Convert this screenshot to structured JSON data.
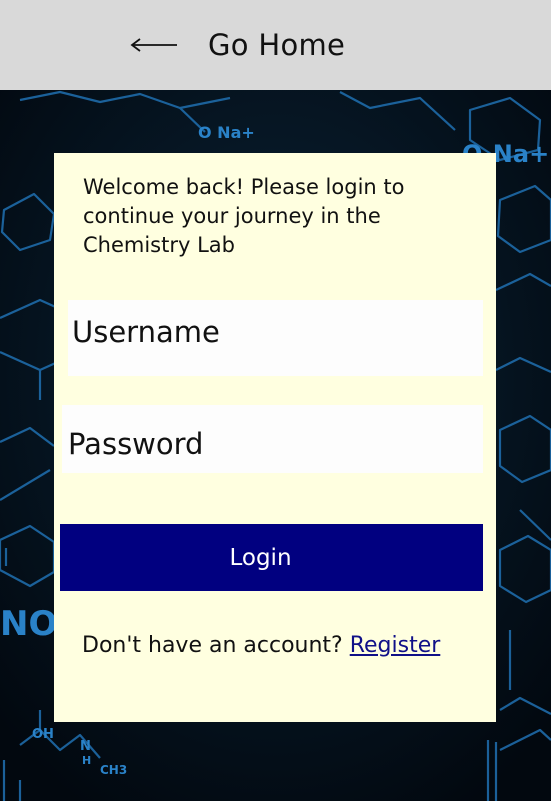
{
  "header": {
    "back_label": "Go Home"
  },
  "login_card": {
    "intro_text": "Welcome back! Please login to continue your journey in the Chemistry Lab",
    "username": {
      "placeholder": "Username",
      "value": ""
    },
    "password": {
      "placeholder": "Password",
      "value": ""
    },
    "login_button_label": "Login",
    "register_prompt": "Don't have an account? ",
    "register_link_label": "Register"
  },
  "background": {
    "formula_labels": [
      "O Na+",
      "O-Na+",
      "NO",
      "OH",
      "N",
      "H",
      "CH3"
    ]
  },
  "colors": {
    "header_bg": "#d9d9d9",
    "card_bg": "#ffffe0",
    "button_bg": "#010080",
    "page_bg": "#04101c",
    "molecule_lines": "#1e6aa8"
  },
  "icons": {
    "back": "long-left-arrow-icon"
  }
}
